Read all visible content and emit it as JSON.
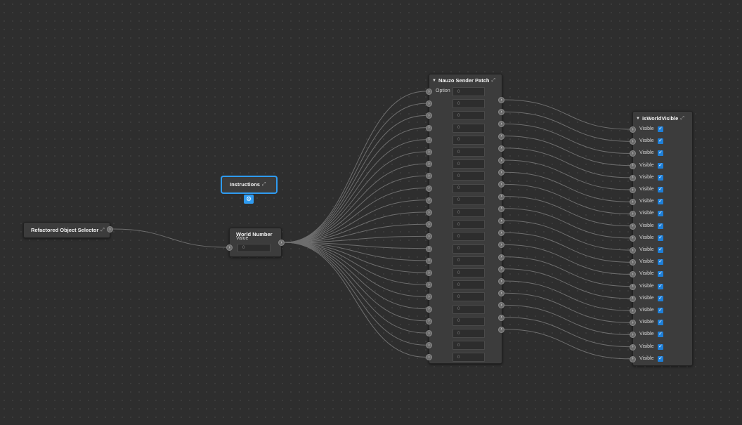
{
  "accent_color": "#2f9bf0",
  "nodes": {
    "object_selector": {
      "title": "Refactored Object Selector",
      "icon": "expand-icon"
    },
    "instructions": {
      "title": "Instructions",
      "icon": "expand-icon",
      "badge_icon": "settings-icon"
    },
    "world_number": {
      "title": "World Number",
      "subtitle": "Value",
      "value": "0"
    },
    "sender_patch": {
      "title": "Nauzo Sender Patch",
      "first_label": "Option",
      "values": [
        "0",
        "0",
        "0",
        "0",
        "0",
        "0",
        "0",
        "0",
        "0",
        "0",
        "0",
        "0",
        "0",
        "0",
        "0",
        "0",
        "0",
        "0",
        "0",
        "0",
        "0",
        "0",
        "0"
      ]
    },
    "is_world_visible": {
      "title": "isWorldVisible",
      "row_label": "Visible",
      "rows": [
        "Visible",
        "Visible",
        "Visible",
        "Visible",
        "Visible",
        "Visible",
        "Visible",
        "Visible",
        "Visible",
        "Visible",
        "Visible",
        "Visible",
        "Visible",
        "Visible",
        "Visible",
        "Visible",
        "Visible",
        "Visible",
        "Visible",
        "Visible"
      ]
    }
  }
}
